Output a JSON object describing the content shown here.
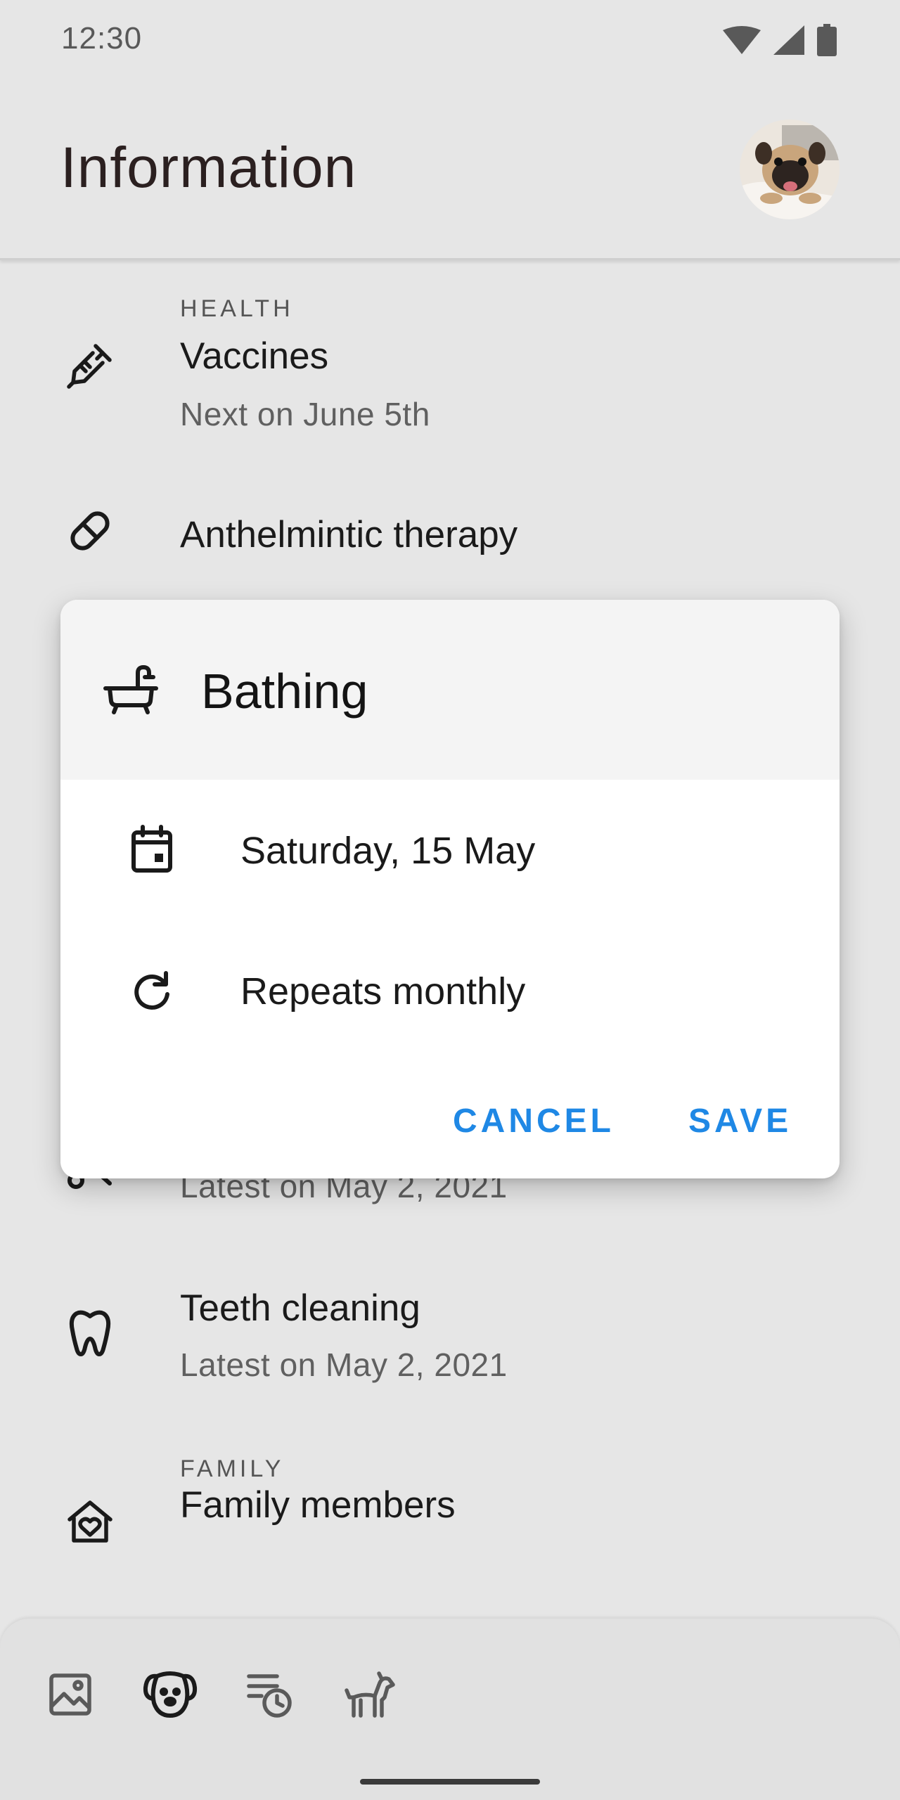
{
  "status_bar": {
    "time": "12:30"
  },
  "header": {
    "title": "Information",
    "avatar_icon": "pug-avatar"
  },
  "list": {
    "health_section_label": "HEALTH",
    "vaccines": {
      "title": "Vaccines",
      "subtitle": "Next on June 5th",
      "icon": "syringe-icon"
    },
    "anthelmintic": {
      "title": "Anthelmintic therapy",
      "icon": "pill-icon"
    },
    "grooming": {
      "subtitle": "Latest on May 2, 2021",
      "icon": "scissors-icon"
    },
    "teeth": {
      "title": "Teeth cleaning",
      "subtitle": "Latest on May 2, 2021",
      "icon": "tooth-icon"
    },
    "family_section_label": "FAMILY",
    "family": {
      "title": "Family members",
      "icon": "home-heart-icon"
    }
  },
  "dialog": {
    "title": "Bathing",
    "title_icon": "bathtub-icon",
    "date": "Saturday, 15 May",
    "date_icon": "calendar-icon",
    "repeat": "Repeats monthly",
    "repeat_icon": "repeat-icon",
    "cancel_label": "CANCEL",
    "save_label": "SAVE"
  },
  "bottom_nav": {
    "items": [
      "gallery-icon",
      "dog-face-icon",
      "schedule-list-icon",
      "dog-icon"
    ]
  },
  "colors": {
    "accent": "#1f88e5",
    "background": "#e6e6e6",
    "dialog_surface": "#ffffff",
    "dialog_header": "#f4f4f4"
  }
}
